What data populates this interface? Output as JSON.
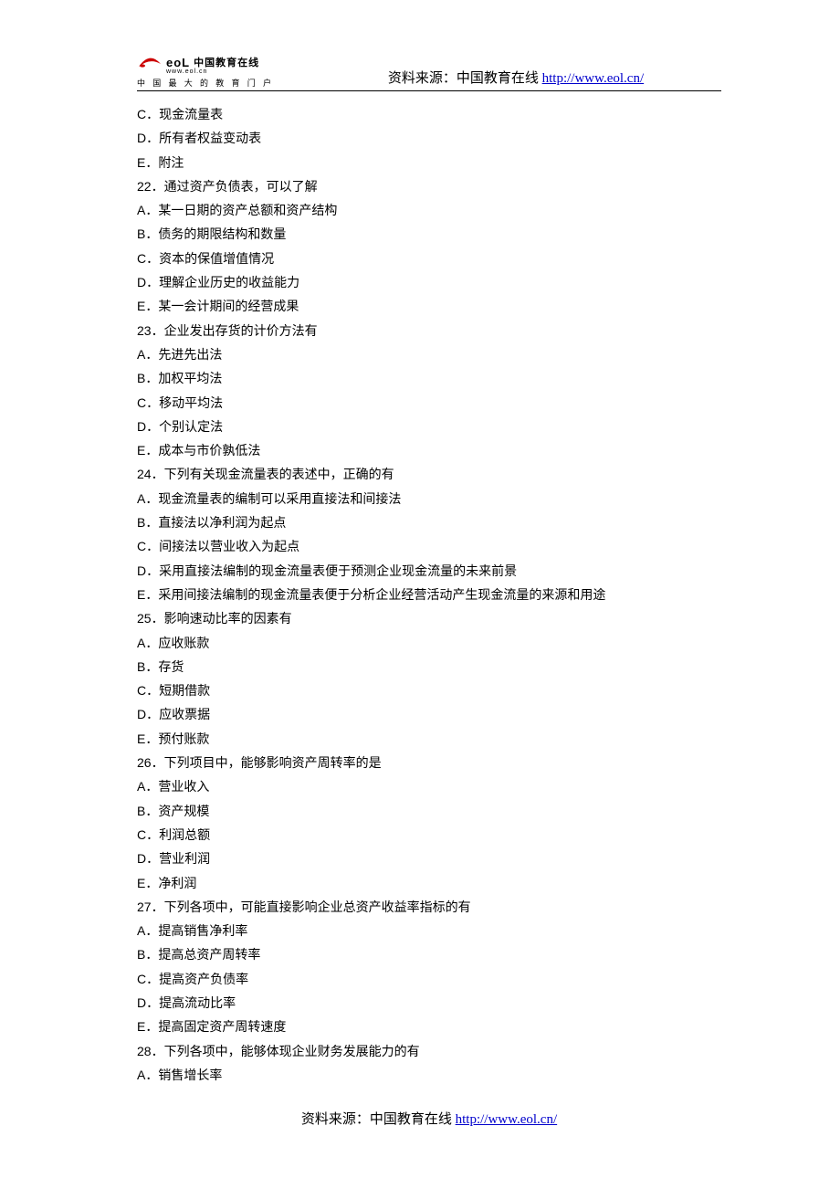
{
  "logo": {
    "eol": "eoL",
    "cn": "中国教育在线",
    "url": "www.eol.cn",
    "sub": "中 国 最 大 的 教 育 门 户"
  },
  "header": {
    "prefix": "资料来源：中国教育在线 ",
    "link": "http://www.eol.cn/"
  },
  "lines": [
    "C．现金流量表",
    "D．所有者权益变动表",
    "E．附注",
    "22．通过资产负债表，可以了解",
    "A．某一日期的资产总额和资产结构",
    "B．债务的期限结构和数量",
    "C．资本的保值增值情况",
    "D．理解企业历史的收益能力",
    "E．某一会计期间的经营成果",
    "23．企业发出存货的计价方法有",
    "A．先进先出法",
    "B．加权平均法",
    "C．移动平均法",
    "D．个别认定法",
    "E．成本与市价孰低法",
    "24．下列有关现金流量表的表述中，正确的有",
    "A．现金流量表的编制可以采用直接法和间接法",
    "B．直接法以净利润为起点",
    "C．间接法以营业收入为起点",
    "D．采用直接法编制的现金流量表便于预测企业现金流量的未来前景",
    "E．采用间接法编制的现金流量表便于分析企业经营活动产生现金流量的来源和用途",
    "25．影响速动比率的因素有",
    "A．应收账款",
    "B．存货",
    "C．短期借款",
    "D．应收票据",
    "E．预付账款",
    "26．下列项目中，能够影响资产周转率的是",
    "A．营业收入",
    "B．资产规模",
    "C．利润总额",
    "D．营业利润",
    "E．净利润",
    "27．下列各项中，可能直接影响企业总资产收益率指标的有",
    "A．提高销售净利率",
    "B．提高总资产周转率",
    "C．提高资产负债率",
    "D．提高流动比率",
    "E．提高固定资产周转速度",
    "28．下列各项中，能够体现企业财务发展能力的有",
    "A．销售增长率"
  ],
  "footer": {
    "prefix": "资料来源：中国教育在线 ",
    "link": "http://www.eol.cn/"
  }
}
